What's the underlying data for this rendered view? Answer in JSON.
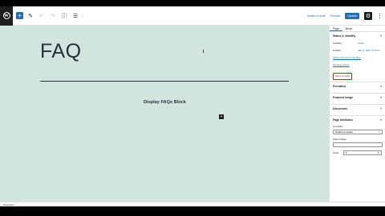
{
  "toolbar": {
    "logo": "W",
    "add_icon": "+",
    "edit_icon": "✎",
    "undo_icon": "↶",
    "redo_icon": "↷",
    "info_icon": "ⓘ",
    "list_icon": "☰",
    "save_draft": "Switch to draft",
    "preview": "Preview",
    "publish": "Update",
    "settings_icon": "⚙",
    "more_icon": "⋮"
  },
  "canvas": {
    "title": "FAQ",
    "block_label": "Display FAQs Block",
    "inserter": "+"
  },
  "sidebar": {
    "tabs": [
      "Page",
      "Block"
    ],
    "status_panel": {
      "title": "Status & visibility",
      "visibility_label": "Visibility",
      "visibility_value": "Public",
      "publish_label": "Publish",
      "publish_value": "May 8, 2021 5:37am",
      "stick_link": "Stick to the top of the blog",
      "pending_link": "Pending review",
      "trash": "Move to trash"
    },
    "permalink": "Permalink",
    "featured_image": "Featured image",
    "discussion": "Discussion",
    "attributes": {
      "title": "Page Attributes",
      "template_label": "Template:",
      "template_value": "Default template",
      "parent_label": "Parent Page:",
      "order_label": "Order",
      "order_value": "0"
    }
  },
  "footer": {
    "breadcrumb": "Document"
  }
}
